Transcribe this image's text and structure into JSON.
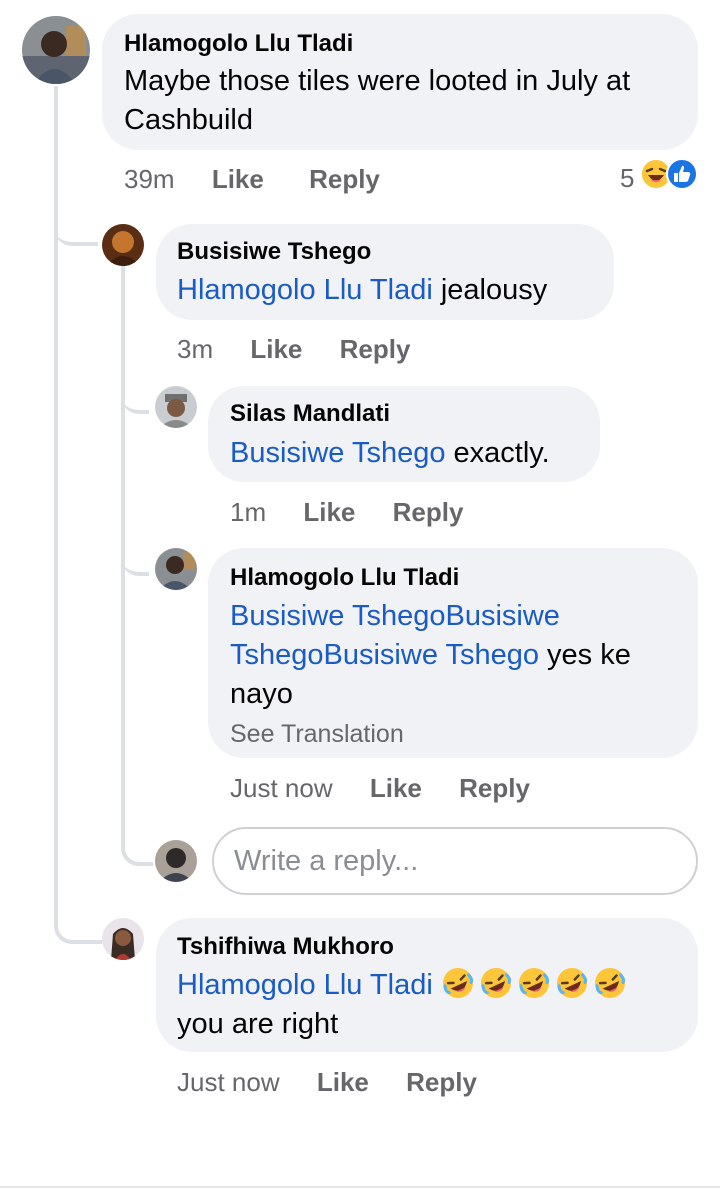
{
  "comments": [
    {
      "author": "Hlamogolo Llu Tladi",
      "text_lines": [
        "Maybe those tiles were looted in July at",
        "Cashbuild"
      ],
      "time": "39m",
      "like": "Like",
      "reply": "Reply",
      "reaction_count": "5",
      "reaction_icons": [
        "laugh-icon",
        "like-icon"
      ]
    },
    {
      "author": "Busisiwe Tshego",
      "mention": "Hlamogolo Llu Tladi",
      "text": " jealousy",
      "time": "3m",
      "like": "Like",
      "reply": "Reply"
    },
    {
      "author": "Silas Mandlati",
      "mention": "Busisiwe Tshego",
      "text": " exactly.",
      "time": "1m",
      "like": "Like",
      "reply": "Reply"
    },
    {
      "author": "Hlamogolo Llu Tladi",
      "mention_line1": "Busisiwe TshegoBusisiwe",
      "mention_line2": "TshegoBusisiwe Tshego",
      "text_line2": " yes ke",
      "text_line3": "nayo",
      "see_translation": "See Translation",
      "time": "Just now",
      "like": "Like",
      "reply": "Reply"
    },
    {
      "author": "Tshifhiwa Mukhoro",
      "mention": "Hlamogolo Llu Tladi",
      "emoji_count": 5,
      "text_line2": "you are right",
      "time": "Just now",
      "like": "Like",
      "reply": "Reply"
    }
  ],
  "reply_box": {
    "placeholder": "Write a reply..."
  },
  "colors": {
    "bubble": "#f0f2f5",
    "mention": "#1a5bc4",
    "meta": "#65676b",
    "thread_line": "#dcdfe3"
  }
}
